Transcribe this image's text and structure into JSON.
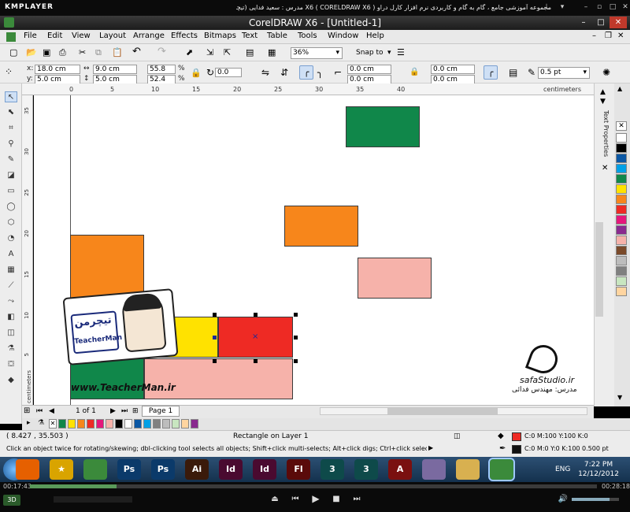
{
  "player": {
    "logo": "KMPLAYER",
    "title": "مجموعه آموزشی جامع ، گام به گام و کاربردی نرم افزار کارل دراو X6 ( CORELDRAW X6 ) مدرس : سعید فدایی (تیچرمن) گروه آموزشی پادشاه گرافیست ها",
    "elapsed": "00:17:43",
    "total": "00:28:18",
    "progress": 0.153,
    "mode_badge": "3D"
  },
  "window": {
    "title": "CorelDRAW X6 - [Untitled-1]"
  },
  "menu": [
    "File",
    "Edit",
    "View",
    "Layout",
    "Arrange",
    "Effects",
    "Bitmaps",
    "Text",
    "Table",
    "Tools",
    "Window",
    "Help"
  ],
  "toolbar": {
    "zoom": "36%",
    "snap_to": "Snap to"
  },
  "props": {
    "x": "18.0 cm",
    "y": "5.0 cm",
    "w": "9.0 cm",
    "h": "5.0 cm",
    "scale_x": "55.8",
    "scale_y": "52.4",
    "pct": "%",
    "angle": "0.0",
    "corner1": "0.0 cm",
    "corner2": "0.0 cm",
    "corner3": "0.0 cm",
    "corner4": "0.0 cm",
    "outline": "0.5 pt"
  },
  "ruler": {
    "units": "centimeters",
    "h_ticks": [
      "0",
      "5",
      "10",
      "15",
      "20",
      "25",
      "30",
      "35",
      "40"
    ],
    "v_ticks": [
      "35",
      "30",
      "25",
      "20",
      "15",
      "10",
      "5"
    ],
    "v_units": "centimeters"
  },
  "shapes": [
    {
      "name": "green-rect-top",
      "color": "#10874a"
    },
    {
      "name": "orange-rect-mid",
      "color": "#f7861b"
    },
    {
      "name": "pink-rect-right",
      "color": "#f6b2aa"
    },
    {
      "name": "orange-rect-left",
      "color": "#f7861b"
    },
    {
      "name": "yellow-rect",
      "color": "#ffe200"
    },
    {
      "name": "red-rect",
      "color": "#ee2a24"
    },
    {
      "name": "pink-rect-bottom",
      "color": "#f6b2aa"
    },
    {
      "name": "green-rect-bottom",
      "color": "#10874a"
    }
  ],
  "watermark": {
    "brand_fa": "تیچرمن",
    "brand_en": "TeacherMan",
    "url": "www.TeacherMan.ir",
    "studio": "safaStudio.ir",
    "credit": "مدرس: مهندس فدائی"
  },
  "docker": {
    "tab": "Text Properties"
  },
  "palette": [
    "#ffffff",
    "#000000",
    "#0a57a4",
    "#00a0e6",
    "#10874a",
    "#ffe200",
    "#f7861b",
    "#ee2a24",
    "#e5177b",
    "#8a2a8f",
    "#f6b2aa",
    "#7a4a2a",
    "#bdbdbd",
    "#808080",
    "#c8e6c0",
    "#ffd5a0"
  ],
  "navigator": {
    "page_count": "1 of 1",
    "page_tab": "Page 1"
  },
  "doc_palette": [
    "#10874a",
    "#ffe200",
    "#f7861b",
    "#ee2a24",
    "#e5177b",
    "#f6b2aa",
    "#000000",
    "#ffffff",
    "#0a57a4",
    "#00a0e6",
    "#808080",
    "#bdbdbd",
    "#c8e6c0",
    "#ffd5a0",
    "#8a2a8f"
  ],
  "status": {
    "coords": "( 8.427 , 35.503 )",
    "object": "Rectangle on Layer 1",
    "hint": "Click an object twice for rotating/skewing; dbl-clicking tool selects all objects; Shift+click multi-selects; Alt+click digs; Ctrl+click selects in a group",
    "fill": "C:0 M:100 Y:100 K:0",
    "outline": "C:0 M:0 Y:0 K:100  0.500 pt",
    "fill_color": "#ee2a24",
    "outline_color": "#111111"
  },
  "taskbar": {
    "apps": [
      {
        "name": "firefox",
        "label": "",
        "color": "#e66000"
      },
      {
        "name": "star-app",
        "label": "★",
        "color": "#d9a400"
      },
      {
        "name": "coreldraw",
        "label": "",
        "color": "#3b8a3b"
      },
      {
        "name": "photoshop-1",
        "label": "Ps",
        "color": "#0b3a6a"
      },
      {
        "name": "photoshop-2",
        "label": "Ps",
        "color": "#0b3a6a"
      },
      {
        "name": "illustrator",
        "label": "Ai",
        "color": "#3a1a0a"
      },
      {
        "name": "indesign-1",
        "label": "Id",
        "color": "#4a0a30"
      },
      {
        "name": "indesign-2",
        "label": "Id",
        "color": "#4a0a30"
      },
      {
        "name": "flash",
        "label": "Fl",
        "color": "#5a0a0a"
      },
      {
        "name": "3dsmax-1",
        "label": "3",
        "color": "#0e4a4a"
      },
      {
        "name": "3dsmax-2",
        "label": "3",
        "color": "#0e4a4a"
      },
      {
        "name": "autocad",
        "label": "A",
        "color": "#7a1010"
      },
      {
        "name": "disc-app",
        "label": "",
        "color": "#7a6aa0"
      },
      {
        "name": "folder-app",
        "label": "",
        "color": "#d8b050"
      },
      {
        "name": "coreldraw-active",
        "label": "",
        "color": "#3b8a3b"
      }
    ],
    "lang": "ENG",
    "time": "7:22 PM",
    "date": "12/12/2012"
  }
}
